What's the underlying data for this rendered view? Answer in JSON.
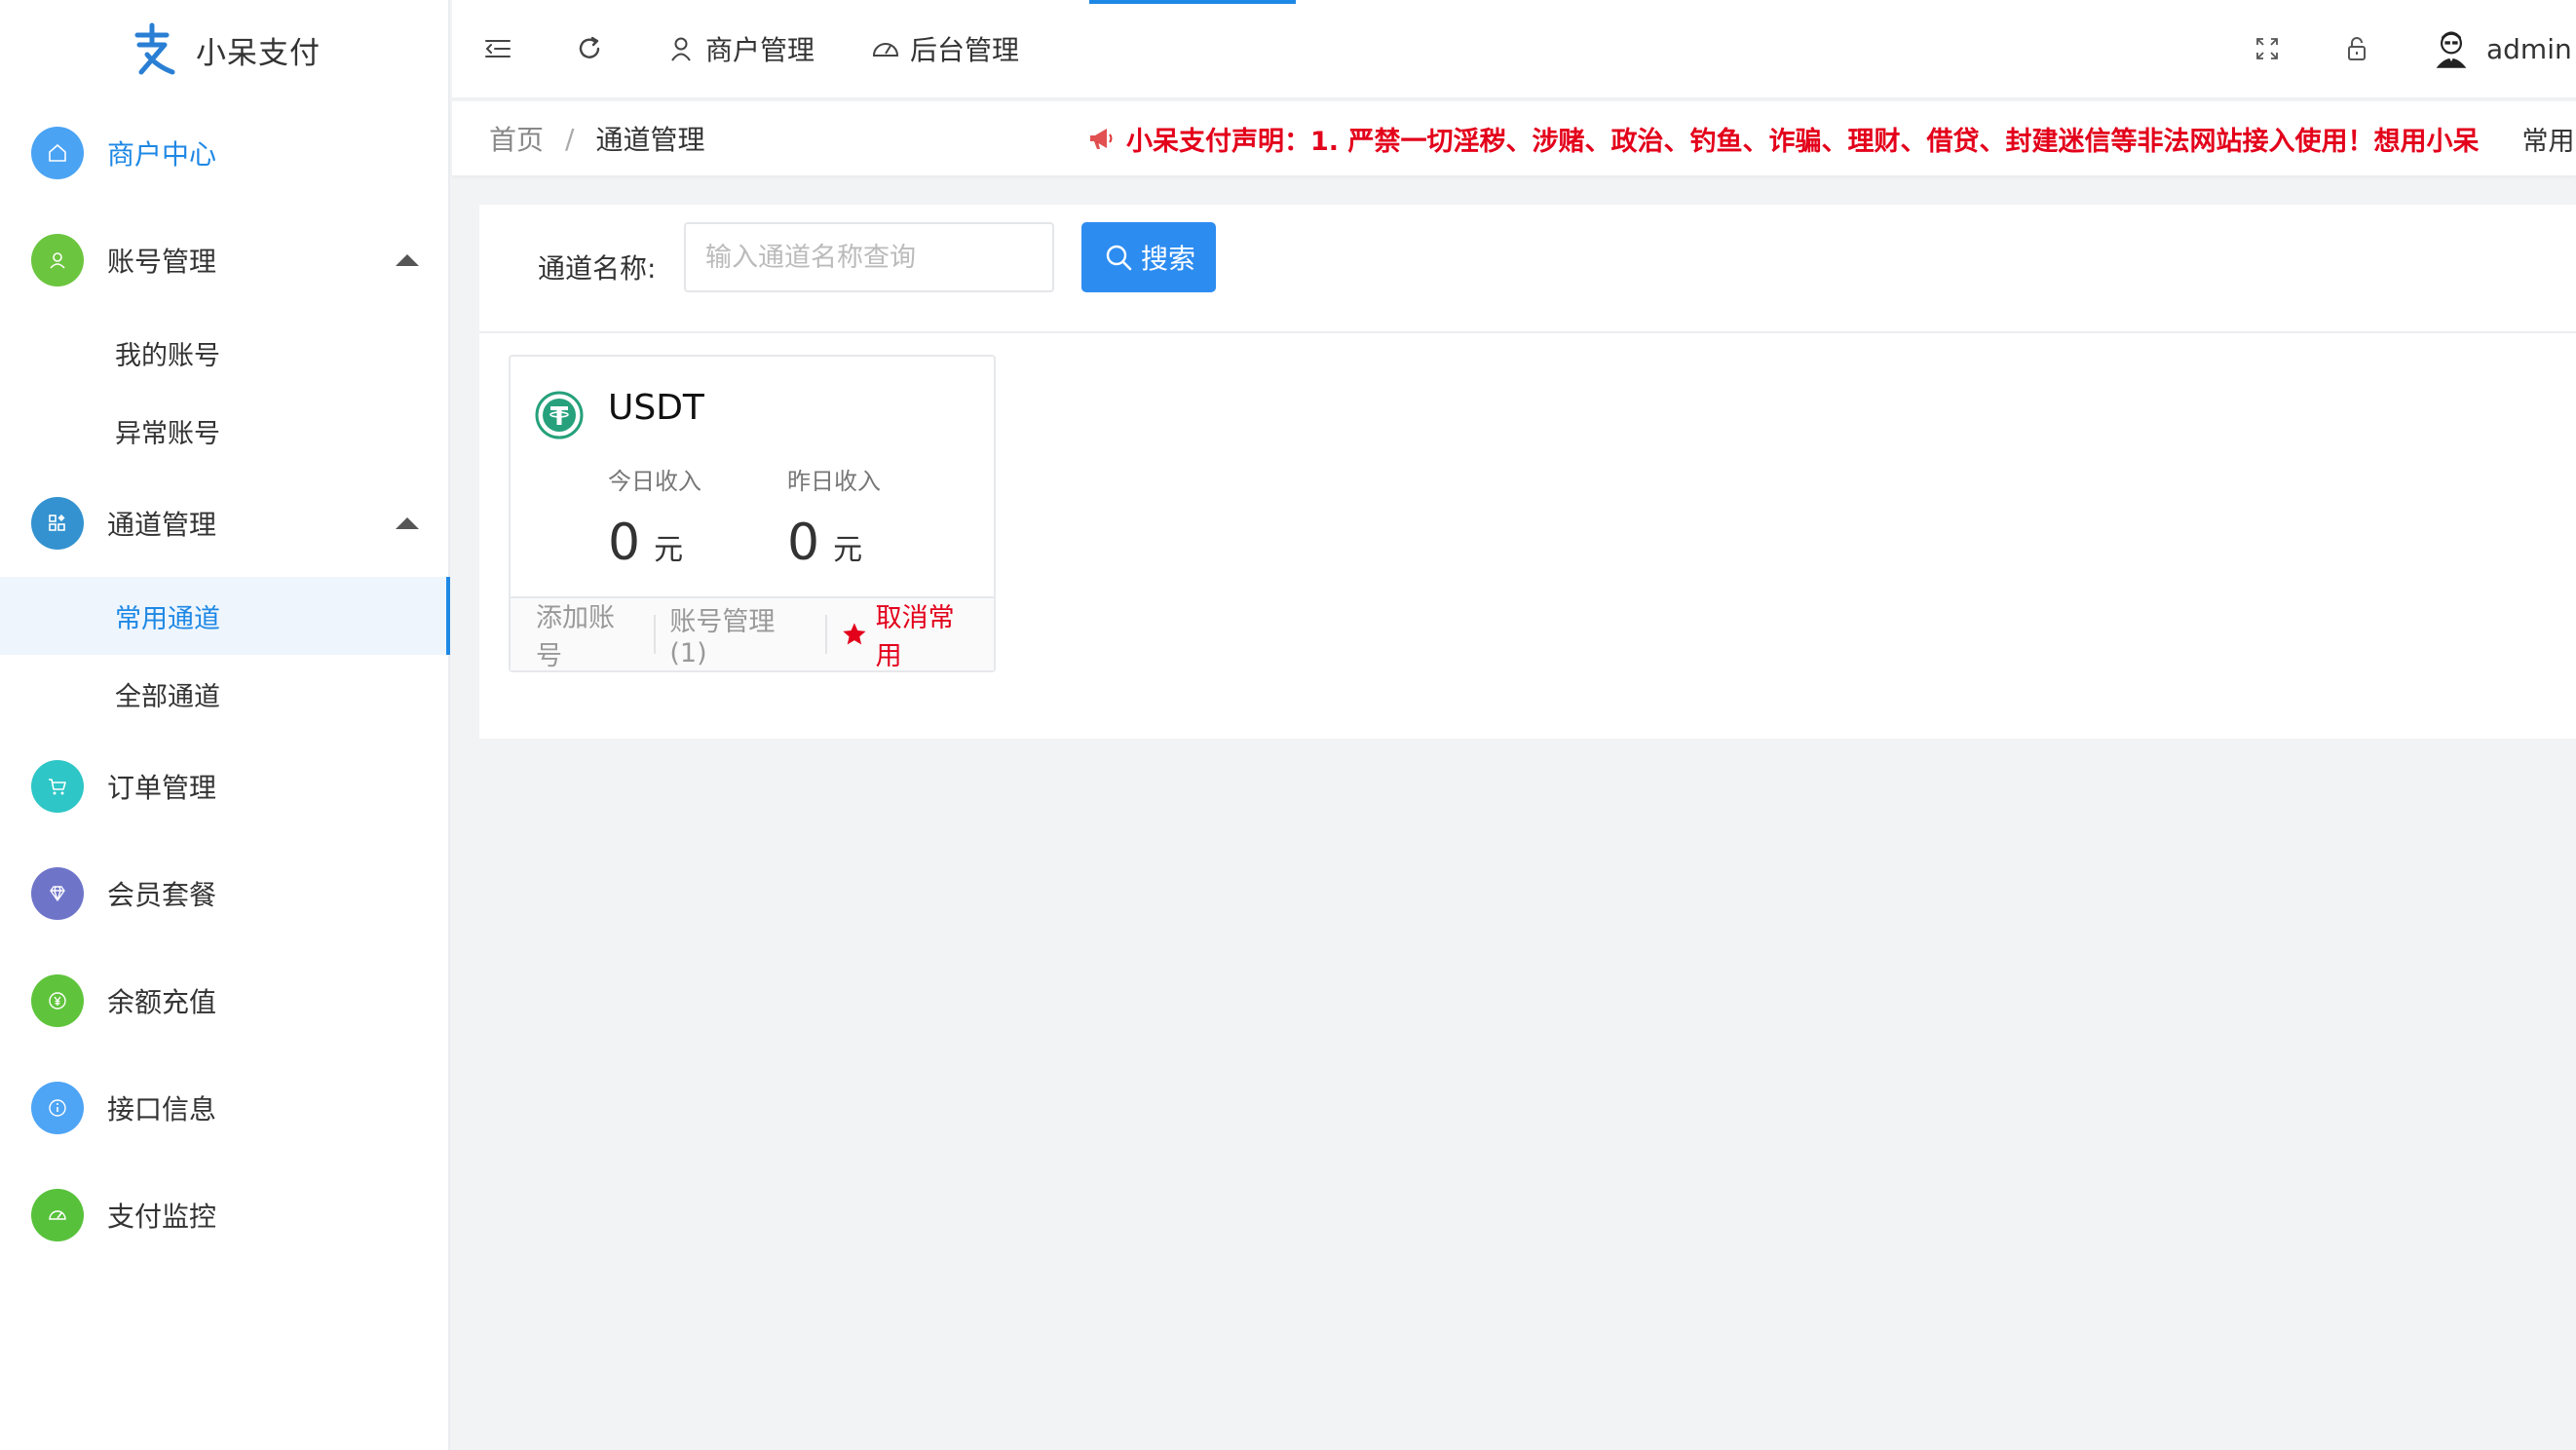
{
  "brand": {
    "name": "小呆支付"
  },
  "sidebar": {
    "items": [
      {
        "label": "商户中心",
        "icon": "home-icon",
        "color": "#3a8ee6",
        "active": true
      },
      {
        "label": "账号管理",
        "icon": "user-icon",
        "color": "#67c23a",
        "expanded": true,
        "children": [
          {
            "label": "我的账号"
          },
          {
            "label": "异常账号"
          }
        ]
      },
      {
        "label": "通道管理",
        "icon": "apps-icon",
        "color": "#3492d0",
        "expanded": true,
        "children": [
          {
            "label": "常用通道",
            "current": true
          },
          {
            "label": "全部通道"
          }
        ]
      },
      {
        "label": "订单管理",
        "icon": "cart-icon",
        "color": "#2ec6c6"
      },
      {
        "label": "会员套餐",
        "icon": "diamond-icon",
        "color": "#6e75c9"
      },
      {
        "label": "余额充值",
        "icon": "yen-icon",
        "color": "#5fc43b"
      },
      {
        "label": "接口信息",
        "icon": "info-icon",
        "color": "#4ea4f5"
      },
      {
        "label": "支付监控",
        "icon": "gauge-icon",
        "color": "#58c13b"
      }
    ]
  },
  "topbar": {
    "merchant_label": "商户管理",
    "backend_label": "后台管理",
    "user_name": "admin"
  },
  "breadcrumb": {
    "home": "首页",
    "separator": "/",
    "current": "通道管理"
  },
  "notice": {
    "text": "小呆支付声明：1. 严禁一切淫秽、涉赌、政治、钓鱼、诈骗、理财、借贷、封建迷信等非法网站接入使用！想用小呆",
    "tail": "常用"
  },
  "search": {
    "label": "通道名称:",
    "placeholder": "输入通道名称查询",
    "button": "搜索"
  },
  "channel_card": {
    "name": "USDT",
    "today_label": "今日收入",
    "today_value": "0",
    "yesterday_label": "昨日收入",
    "yesterday_value": "0",
    "unit": "元",
    "actions": {
      "add": "添加账号",
      "manage": "账号管理(1)",
      "unfavorite": "取消常用"
    }
  },
  "colors": {
    "accent": "#1e88e5",
    "primary_button": "#2d8cf0",
    "notice": "#e3001b",
    "usdt": "#26a17b"
  }
}
